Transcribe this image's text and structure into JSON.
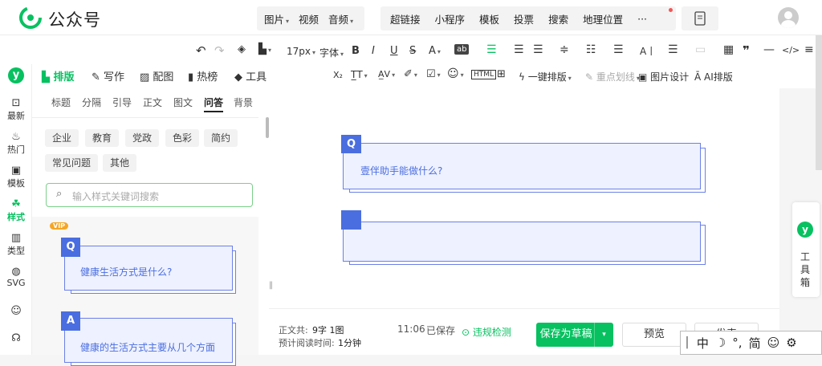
{
  "brand": {
    "name": "公众号"
  },
  "topbar": {
    "insert_group": [
      {
        "label": "图片",
        "dropdown": true
      },
      {
        "label": "视频",
        "dropdown": false
      },
      {
        "label": "音频",
        "dropdown": true
      }
    ],
    "tool_group": [
      {
        "label": "超链接"
      },
      {
        "label": "小程序"
      },
      {
        "label": "模板"
      },
      {
        "label": "投票"
      },
      {
        "label": "搜索"
      },
      {
        "label": "地理位置"
      }
    ],
    "more_label": "···"
  },
  "toolbar1": {
    "font_size": "17px",
    "font_family": "字体",
    "bold": "B",
    "italic": "I",
    "underline": "U",
    "strike": "S",
    "color": "A",
    "tab_ai": "A丨",
    "code": "</>",
    "quote": "❞"
  },
  "mode_tabs": [
    {
      "label": "排版",
      "active": true
    },
    {
      "label": "写作"
    },
    {
      "label": "配图"
    },
    {
      "label": "热榜"
    },
    {
      "label": "工具"
    }
  ],
  "toolbar2": {
    "one_click": "一键排版",
    "highlight": "重点划线",
    "img_design": "图片设计",
    "ai_layout": "AI排版",
    "sub": "X₂"
  },
  "rail": [
    {
      "label": "最新"
    },
    {
      "label": "热门"
    },
    {
      "label": "模板"
    },
    {
      "label": "样式",
      "active": true
    },
    {
      "label": "类型"
    },
    {
      "label": "SVG"
    }
  ],
  "panel": {
    "tabs": [
      {
        "label": "标题"
      },
      {
        "label": "分隔"
      },
      {
        "label": "引导"
      },
      {
        "label": "正文"
      },
      {
        "label": "图文"
      },
      {
        "label": "问答",
        "active": true
      },
      {
        "label": "背景"
      }
    ],
    "chips": [
      {
        "label": "企业"
      },
      {
        "label": "教育"
      },
      {
        "label": "党政"
      },
      {
        "label": "色彩"
      },
      {
        "label": "简约"
      },
      {
        "label": "常见问题"
      },
      {
        "label": "其他"
      }
    ],
    "search_placeholder": "输入样式关键词搜索",
    "vip": "VIP",
    "samples": [
      {
        "badge": "Q",
        "text": "健康生活方式是什么?"
      },
      {
        "badge": "A",
        "text": "健康的生活方式主要从几个方面"
      }
    ]
  },
  "editor": {
    "blocks": [
      {
        "badge": "Q",
        "text": "壹伴助手能做什么?"
      },
      {
        "badge": "",
        "text": ""
      }
    ]
  },
  "bottom": {
    "word_label": "正文共:",
    "word_value": "9字 1图",
    "read_label": "预计阅读时间:",
    "read_value": "1分钟",
    "save_time": "11:06",
    "save_status": "已保存",
    "check": "违规检测",
    "save_draft": "保存为草稿",
    "preview": "预览",
    "publish": "发表"
  },
  "float": {
    "label_1": "工",
    "label_2": "具",
    "label_3": "箱"
  },
  "ime": {
    "items": [
      "中",
      "简"
    ]
  },
  "colors": {
    "green": "#07c160",
    "blue": "#4a6ee0"
  }
}
